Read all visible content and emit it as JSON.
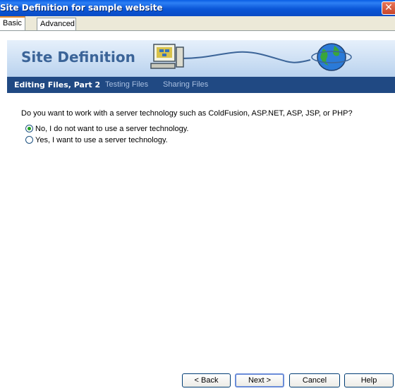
{
  "window": {
    "title": "Site Definition for sample website",
    "close_glyph": "✕"
  },
  "tabs": [
    {
      "label": "Basic",
      "active": true
    },
    {
      "label": "Advanced",
      "active": false
    }
  ],
  "banner": {
    "heading": "Site Definition",
    "icons": [
      "computer-icon",
      "globe-icon"
    ]
  },
  "steps": [
    {
      "label": "Editing Files, Part 2",
      "active": true
    },
    {
      "label": "Testing Files",
      "active": false
    },
    {
      "label": "Sharing Files",
      "active": false
    }
  ],
  "content": {
    "question": "Do you want to work with a server technology such as ColdFusion, ASP.NET, ASP, JSP, or PHP?",
    "options": [
      {
        "label": "No, I do not want to use a server technology.",
        "selected": true
      },
      {
        "label": "Yes, I want to use a server technology.",
        "selected": false
      }
    ]
  },
  "buttons": {
    "back": "< Back",
    "next": "Next >",
    "cancel": "Cancel",
    "help": "Help"
  },
  "colors": {
    "titlebar": "#0a56d8",
    "step_bar": "#204983",
    "banner_text": "#3b6498",
    "radio_dot": "#21a121"
  }
}
